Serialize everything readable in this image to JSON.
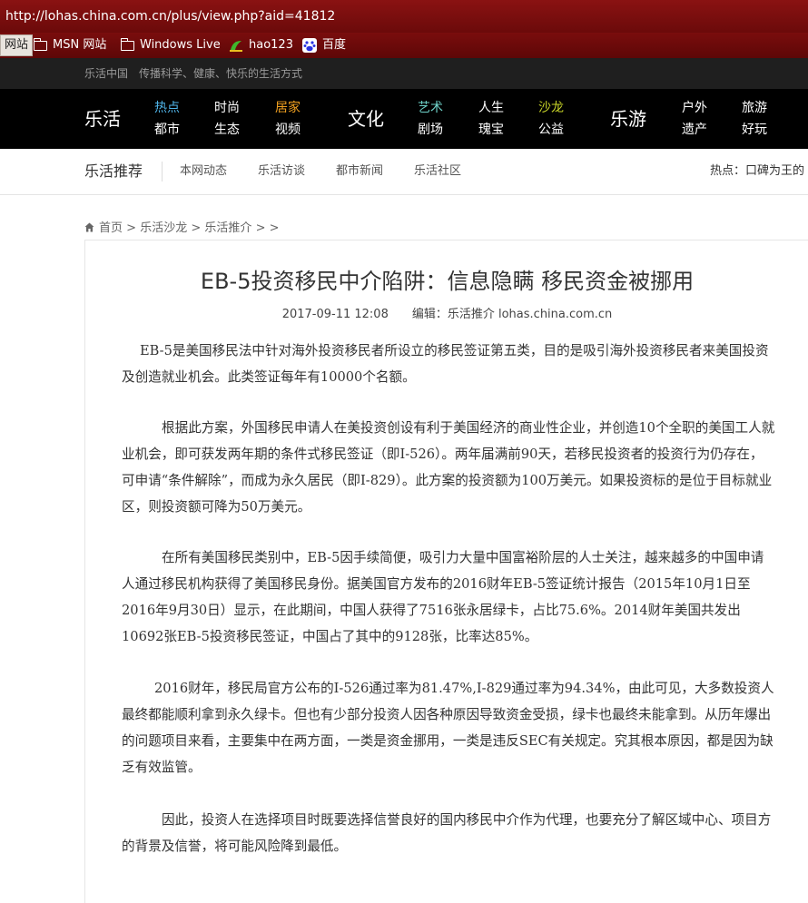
{
  "browser": {
    "url": "http://lohas.china.com.cn/plus/view.php?aid=41812",
    "bookmarks": [
      "网站",
      "MSN 网站",
      "Windows Live",
      "hao123",
      "百度"
    ]
  },
  "site": {
    "top_strip": "乐活中国　传播科学、健康、快乐的生活方式",
    "nav": {
      "lohas": "乐活",
      "hot": "热点",
      "city": "都市",
      "fashion": "时尚",
      "eco": "生态",
      "home": "居家",
      "video": "视频",
      "culture": "文化",
      "art": "艺术",
      "theater": "剧场",
      "life": "人生",
      "treasure": "瑰宝",
      "salon": "沙龙",
      "charity": "公益",
      "travel": "乐游",
      "outdoor": "户外",
      "heritage": "遗产",
      "tour": "旅游",
      "fun": "好玩"
    },
    "accent_colors": {
      "hot": "#4fb3e8",
      "home": "#f0a020",
      "art": "#6ed1c8",
      "salon": "#c7d428"
    },
    "subnav": {
      "title": "乐活推荐",
      "items": [
        "本网动态",
        "乐活访谈",
        "都市新闻",
        "乐活社区"
      ],
      "hot_text": "热点：口碑为王的"
    }
  },
  "breadcrumb": {
    "home": "首页",
    "salon": "乐活沙龙",
    "promo": "乐活推介",
    "sep": ">",
    "tail": "> >"
  },
  "article": {
    "title": "EB-5投资移民中介陷阱：信息隐瞒 移民资金被挪用",
    "date": "2017-09-11 12:08",
    "editor": "编辑：乐活推介 lohas.china.com.cn",
    "paragraphs": [
      "EB-5是美国移民法中针对海外投资移民者所设立的移民签证第五类，目的是吸引海外投资移民者来美国投资及创造就业机会。此类签证每年有10000个名额。",
      "根据此方案，外国移民申请人在美投资创设有利于美国经济的商业性企业，并创造10个全职的美国工人就业机会，即可获发两年期的条件式移民签证（即I-526）。两年届满前90天，若移民投资者的投资行为仍存在，可申请“条件解除”，而成为永久居民（即I-829）。此方案的投资额为100万美元。如果投资标的是位于目标就业区，则投资额可降为50万美元。",
      "在所有美国移民类别中，EB-5因手续简便，吸引力大量中国富裕阶层的人士关注，越来越多的中国申请人通过移民机构获得了美国移民身份。据美国官方发布的2016财年EB-5签证统计报告（2015年10月1日至2016年9月30日）显示，在此期间，中国人获得了7516张永居绿卡，占比75.6%。2014财年美国共发出10692张EB-5投资移民签证，中国占了其中的9128张，比率达85%。",
      "2016财年，移民局官方公布的I-526通过率为81.47%,I-829通过率为94.34%，由此可见，大多数投资人最终都能顺利拿到永久绿卡。但也有少部分投资人因各种原因导致资金受损，绿卡也最终未能拿到。从历年爆出的问题项目来看，主要集中在两方面，一类是资金挪用，一类是违反SEC有关规定。究其根本原因，都是因为缺乏有效监管。",
      "因此，投资人在选择项目时既要选择信誉良好的国内移民中介作为代理，也要充分了解区域中心、项目方的背景及信誉，将可能风险降到最低。"
    ]
  }
}
